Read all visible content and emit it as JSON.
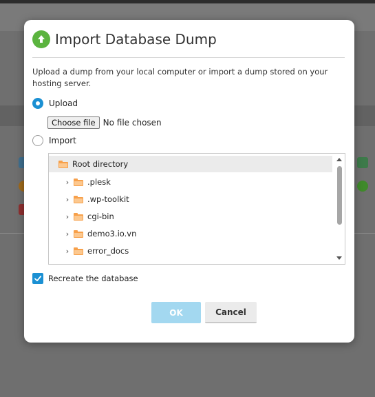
{
  "dialog": {
    "title": "Import Database Dump",
    "description": "Upload a dump from your local computer or import a dump stored on your hosting server.",
    "upload_option": {
      "label": "Upload",
      "selected": true
    },
    "file_input": {
      "button_label": "Choose file",
      "status": "No file chosen"
    },
    "import_option": {
      "label": "Import",
      "selected": false
    },
    "tree": {
      "root": "Root directory",
      "folders": [
        ".plesk",
        ".wp-toolkit",
        "cgi-bin",
        "demo3.io.vn",
        "error_docs"
      ]
    },
    "recreate_checkbox": {
      "label": "Recreate the database",
      "checked": true
    },
    "ok_label": "OK",
    "cancel_label": "Cancel"
  },
  "colors": {
    "accent": "#1b90d3",
    "title_icon": "#5bb43f",
    "folder": "#f7a04a",
    "ok_disabled": "#a3d8f0"
  },
  "icons": {
    "title": "upload-icon",
    "folder": "folder-icon",
    "expand": "chevron-right-icon"
  }
}
